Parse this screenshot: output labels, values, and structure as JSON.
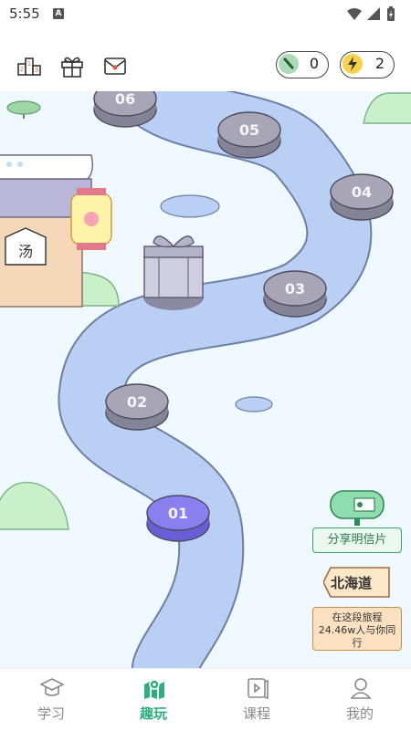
{
  "status_bar": {
    "time": "5:55",
    "app_indicator": "A"
  },
  "top_bar": {
    "icons": [
      "leaderboard-icon",
      "gift-icon",
      "mail-icon"
    ],
    "coin_count": "0",
    "energy_count": "2"
  },
  "map": {
    "levels": [
      {
        "label": "06",
        "state": "locked"
      },
      {
        "label": "05",
        "state": "locked"
      },
      {
        "label": "04",
        "state": "locked"
      },
      {
        "label": "03",
        "state": "locked"
      },
      {
        "label": "02",
        "state": "locked"
      },
      {
        "label": "01",
        "state": "current"
      }
    ],
    "house_sign": "汤",
    "postcard_button": "分享明信片",
    "location_name": "北海道",
    "journey_lines": [
      "在这段旅程",
      "24.46w人与你同",
      "行"
    ]
  },
  "tabs": [
    {
      "label": "学习",
      "icon": "graduation-cap-icon",
      "active": false
    },
    {
      "label": "趣玩",
      "icon": "map-icon",
      "active": true
    },
    {
      "label": "课程",
      "icon": "video-book-icon",
      "active": false
    },
    {
      "label": "我的",
      "icon": "person-icon",
      "active": false
    }
  ],
  "colors": {
    "accent": "#2fae7d",
    "river": "#b9cff3",
    "stone": "#a8a6b6",
    "current_level": "#8b7ff0",
    "map_bg": "#eef8fd"
  }
}
